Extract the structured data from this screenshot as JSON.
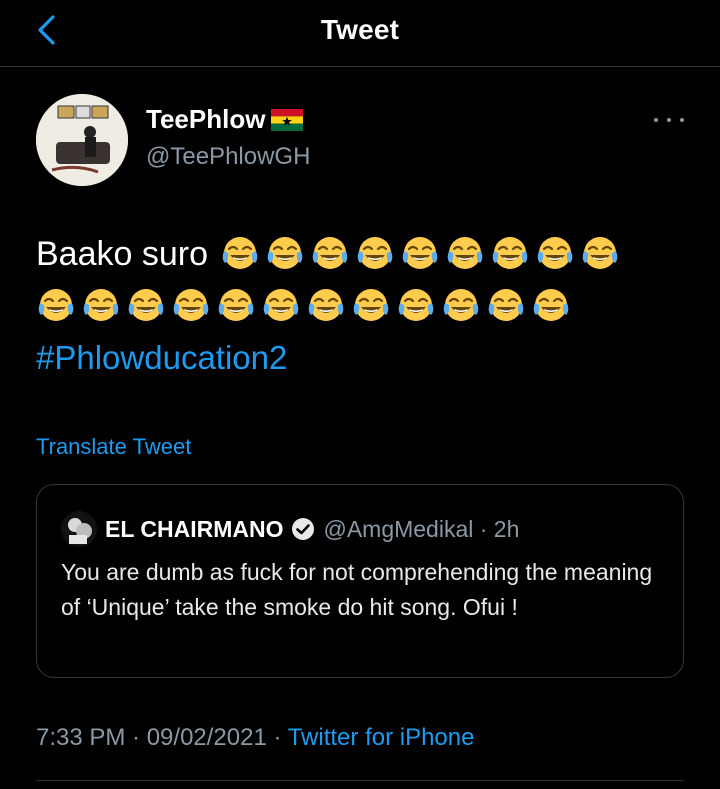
{
  "header": {
    "title": "Tweet",
    "back_icon": "chevron-left-icon"
  },
  "author": {
    "display_name": "TeePhlow",
    "flag_icon": "ghana-flag-icon",
    "handle": "@TeePhlowGH"
  },
  "tweet": {
    "line1_text": "Baako suro",
    "line1_emoji_count": 9,
    "line2_emoji_count": 12,
    "emoji_name": "face-with-tears-of-joy-icon",
    "hashtag": "#Phlowducation2",
    "translate_label": "Translate Tweet"
  },
  "quote": {
    "name": "EL CHAIRMANO",
    "handle_time": "@AmgMedikal · 2h",
    "text": "You are dumb as fuck for not comprehending the meaning of ‘Unique’ take the smoke do hit song. Ofui !"
  },
  "meta": {
    "time_date": "7:33 PM · 09/02/2021 · ",
    "source": "Twitter for iPhone"
  },
  "colors": {
    "accent": "#1d9bf0",
    "muted": "#8b98a5",
    "border": "#2f3336",
    "background": "#000000"
  }
}
